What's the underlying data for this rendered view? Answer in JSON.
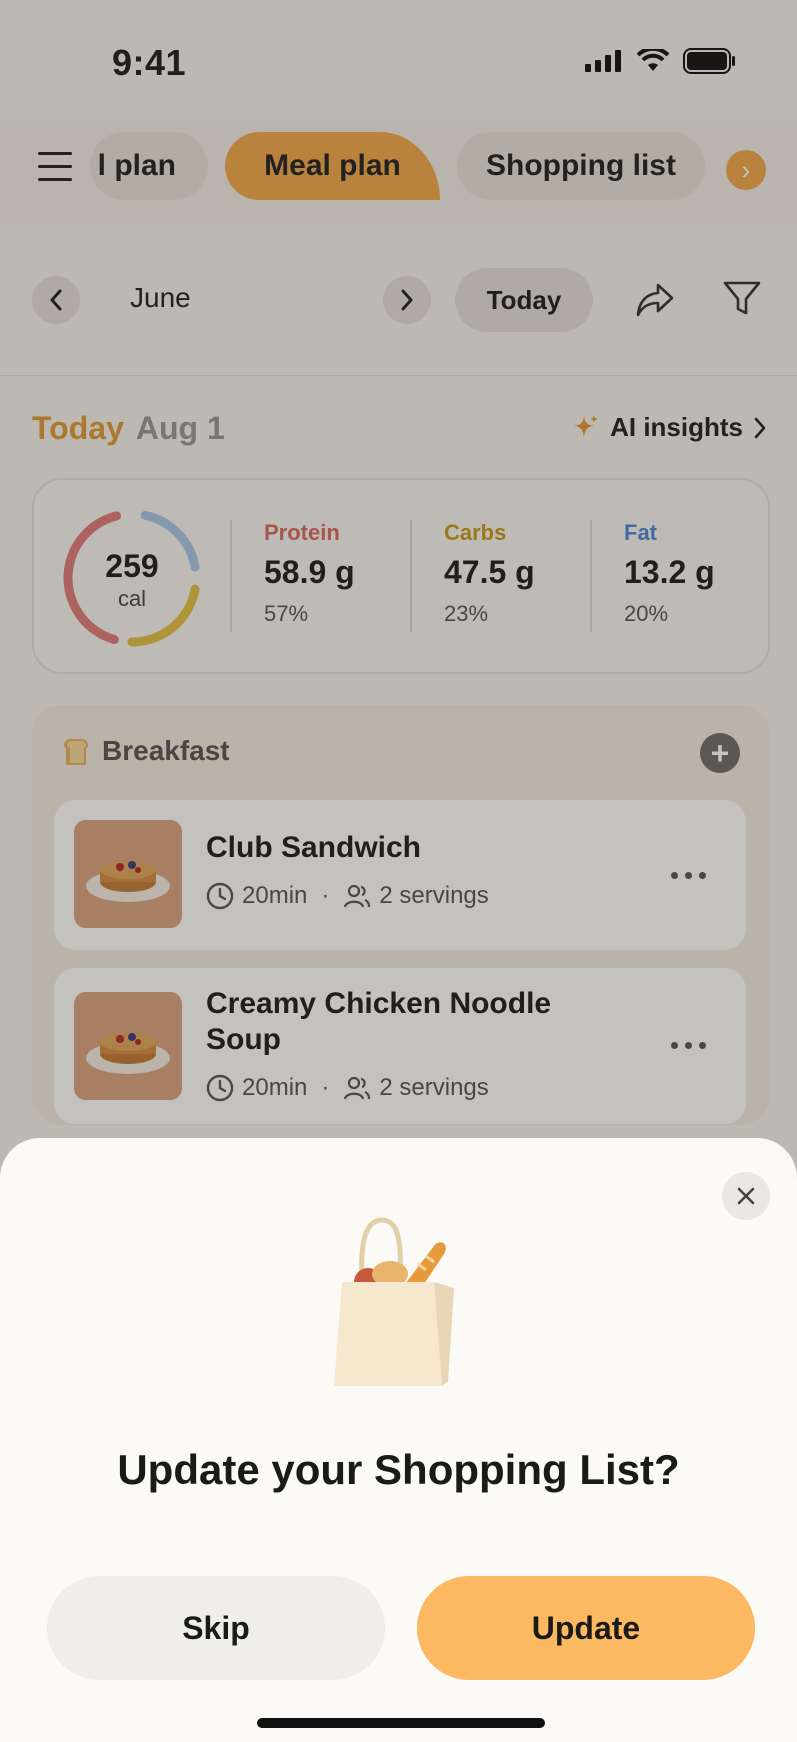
{
  "status_bar": {
    "time": "9:41"
  },
  "tabs": {
    "items": [
      {
        "label": "l plan"
      },
      {
        "label": "Meal plan",
        "active": true
      },
      {
        "label": "Shopping list"
      }
    ]
  },
  "date_nav": {
    "month": "June",
    "today_label": "Today"
  },
  "day_header": {
    "today": "Today",
    "date": "Aug 1",
    "insights_label": "AI insights"
  },
  "nutrition": {
    "calories": {
      "value": "259",
      "unit": "cal"
    },
    "macros": [
      {
        "name": "Protein",
        "amount": "58.9 g",
        "percent": "57%",
        "color": "#d9685f"
      },
      {
        "name": "Carbs",
        "amount": "47.5 g",
        "percent": "23%",
        "color": "#c59a1c"
      },
      {
        "name": "Fat",
        "amount": "13.2 g",
        "percent": "20%",
        "color": "#4a86d4"
      }
    ],
    "ring_colors": {
      "protein": "#e07c79",
      "carbs": "#e3bf45",
      "fat": "#a9c7e6"
    }
  },
  "meal": {
    "name": "Breakfast",
    "recipes": [
      {
        "title": "Club Sandwich",
        "time": "20min",
        "servings": "2 servings"
      },
      {
        "title": "Creamy Chicken Noodle Soup",
        "time": "20min",
        "servings": "2 servings"
      }
    ]
  },
  "sheet": {
    "title": "Update your Shopping List?",
    "skip_label": "Skip",
    "update_label": "Update"
  },
  "colors": {
    "accent": "#f3a84a",
    "update_button": "#fdb862"
  }
}
